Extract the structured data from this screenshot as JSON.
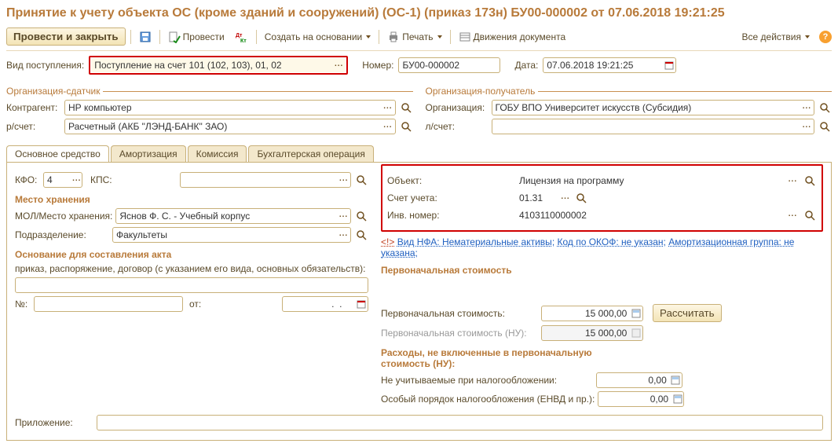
{
  "title": "Принятие к учету объекта ОС (кроме зданий и сооружений) (ОС-1) (приказ 173н) БУ00-000002 от 07.06.2018 19:21:25",
  "toolbar": {
    "post_close": "Провести и закрыть",
    "provesti": "Провести",
    "create_based": "Создать на основании",
    "print": "Печать",
    "movements": "Движения документа",
    "all_actions": "Все действия"
  },
  "header": {
    "receipt_type_label": "Вид поступления:",
    "receipt_type": "Поступление на счет 101 (102, 103), 01, 02",
    "number_label": "Номер:",
    "number": "БУ00-000002",
    "date_label": "Дата:",
    "date": "07.06.2018 19:21:25"
  },
  "sender": {
    "legend": "Организация-сдатчик",
    "kontragent_label": "Контрагент:",
    "kontragent": "НР компьютер",
    "account_label": "р/счет:",
    "account": "Расчетный (АКБ \"ЛЭНД-БАНК\" ЗАО)"
  },
  "receiver": {
    "legend": "Организация-получатель",
    "org_label": "Организация:",
    "org": "ГОБУ ВПО Университет искусств (Субсидия)",
    "laccount_label": "л/счет:"
  },
  "tabs": {
    "t1": "Основное средство",
    "t2": "Амортизация",
    "t3": "Комиссия",
    "t4": "Бухгалтерская операция"
  },
  "os": {
    "kfo_label": "КФО:",
    "kfo": "4",
    "kps_label": "КПС:",
    "kps": "",
    "storage_head": "Место хранения",
    "mol_label": "МОЛ/Место хранения:",
    "mol": "Яснов Ф. С. - Учебный корпус",
    "dept_label": "Подразделение:",
    "dept": "Факультеты",
    "akt_head": "Основание для составления акта",
    "akt_desc": "приказ, распоряжение, договор (с указанием его вида, основных обязательств):",
    "num_label": "№:",
    "ot_label": "от:",
    "object_label": "Объект:",
    "object": "Лицензия на программу",
    "account_label": "Счет учета:",
    "account": "01.31",
    "inv_label": "Инв. номер:",
    "inv": "4103110000002",
    "nfa_warn": "<!>",
    "nfa_line1": "Вид НФА: Нематериальные активы",
    "nfa_line2": "Код по ОКОФ: не указан",
    "nfa_line3": "Амортизационная группа: не указана",
    "first_cost_head": "Первоначальная стоимость",
    "first_cost_label": "Первоначальная стоимость:",
    "first_cost": "15 000,00",
    "calc": "Рассчитать",
    "first_cost_nu_label": "Первоначальная стоимость (НУ):",
    "first_cost_nu": "15 000,00",
    "expenses_head": "Расходы, не включенные в первоначальную стоимость (НУ):",
    "notax_label": "Не учитываемые при налогообложении:",
    "notax": "0,00",
    "envd_label": "Особый порядок налогообложения (ЕНВД и пр.):",
    "envd": "0,00",
    "attach_label": "Приложение:"
  }
}
